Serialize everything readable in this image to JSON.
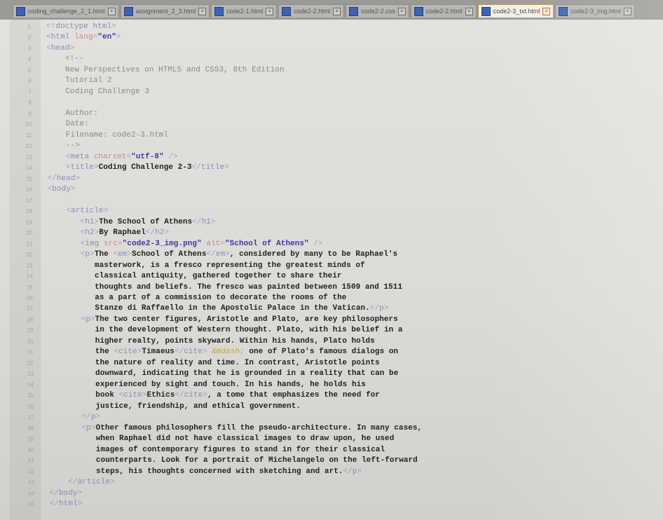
{
  "tabs": [
    {
      "label": "coding_challenge_2_1.html"
    },
    {
      "label": "assignment_2_3.html"
    },
    {
      "label": "code2-1.html"
    },
    {
      "label": "code2-2.html"
    },
    {
      "label": "code2-2.css"
    },
    {
      "label": "code2-2.html"
    },
    {
      "label": "code2-3_txt.html",
      "active": true
    },
    {
      "label": "code2-3_img.html"
    }
  ],
  "active_tab_color": "#d58e2a",
  "lines": [
    {
      "n": "1",
      "html": "<span class='ang'>&lt;!</span><span class='tag'>doctype html</span><span class='ang'>&gt;</span>"
    },
    {
      "n": "2",
      "html": "<span class='ang'>&lt;</span><span class='tag'>html</span> <span class='attr'>lang=</span><span class='val'>\"en\"</span><span class='ang'>&gt;</span>"
    },
    {
      "n": "3",
      "html": "<span class='ang'>&lt;</span><span class='tag'>head</span><span class='ang'>&gt;</span>"
    },
    {
      "n": "4",
      "html": "    <span class='cm'>&lt;!--</span>"
    },
    {
      "n": "5",
      "html": "    <span class='cm'>New Perspectives on HTML5 and CSS3, 8th Edition</span>"
    },
    {
      "n": "6",
      "html": "    <span class='cm'>Tutorial 2</span>"
    },
    {
      "n": "7",
      "html": "    <span class='cm'>Coding Challenge 3</span>"
    },
    {
      "n": "8",
      "html": ""
    },
    {
      "n": "9",
      "html": "    <span class='cm'>Author:</span>"
    },
    {
      "n": "10",
      "html": "    <span class='cm'>Date:</span>"
    },
    {
      "n": "11",
      "html": "    <span class='cm'>Filename: code2-3.html</span>"
    },
    {
      "n": "12",
      "html": "    <span class='cm'>--&gt;</span>"
    },
    {
      "n": "13",
      "html": "    <span class='ang'>&lt;</span><span class='tag'>meta</span> <span class='attr'>charset=</span><span class='val'>\"utf-8\"</span> <span class='ang'>/&gt;</span>"
    },
    {
      "n": "14",
      "html": "    <span class='ang'>&lt;</span><span class='tag'>title</span><span class='ang'>&gt;</span><span class='bold'>Coding Challenge 2-3</span><span class='ang'>&lt;/</span><span class='tag'>title</span><span class='ang'>&gt;</span>"
    },
    {
      "n": "15",
      "html": "<span class='ang'>&lt;/</span><span class='tag'>head</span><span class='ang'>&gt;</span>"
    },
    {
      "n": "16",
      "html": "<span class='ang'>&lt;</span><span class='tag'>body</span><span class='ang'>&gt;</span>"
    },
    {
      "n": "17",
      "html": ""
    },
    {
      "n": "18",
      "html": "    <span class='ang'>&lt;</span><span class='tag'>article</span><span class='ang'>&gt;</span>"
    },
    {
      "n": "19",
      "html": "       <span class='ang'>&lt;</span><span class='tag'>h1</span><span class='ang'>&gt;</span><span class='bold'>The School of Athens</span><span class='ang'>&lt;/</span><span class='tag'>h1</span><span class='ang'>&gt;</span>"
    },
    {
      "n": "20",
      "html": "       <span class='ang'>&lt;</span><span class='tag'>h2</span><span class='ang'>&gt;</span><span class='bold'>By Raphael</span><span class='ang'>&lt;/</span><span class='tag'>h2</span><span class='ang'>&gt;</span>"
    },
    {
      "n": "21",
      "html": "       <span class='ang'>&lt;</span><span class='tag'>img</span> <span class='attr'>src=</span><span class='val'>\"code2-3_img.png\"</span> <span class='attr'>alt=</span><span class='val'>\"School of Athens\"</span> <span class='ang'>/&gt;</span>"
    },
    {
      "n": "22",
      "html": "       <span class='ang'>&lt;</span><span class='tag'>p</span><span class='ang'>&gt;</span><span class='bold'>The </span><span class='ang'>&lt;</span><span class='tag'>em</span><span class='ang'>&gt;</span><span class='bold'>School of Athens</span><span class='ang'>&lt;/</span><span class='tag'>em</span><span class='ang'>&gt;</span><span class='bold'>, considered by many to be Raphael's</span>"
    },
    {
      "n": "23",
      "html": "          <span class='bold'>masterwork, is a fresco representing the greatest minds of</span>"
    },
    {
      "n": "24",
      "html": "          <span class='bold'>classical antiquity, gathered together to share their</span>"
    },
    {
      "n": "25",
      "html": "          <span class='bold'>thoughts and beliefs. The fresco was painted between 1509 and 1511</span>"
    },
    {
      "n": "26",
      "html": "          <span class='bold'>as a part of a commission to decorate the rooms of the</span>"
    },
    {
      "n": "27",
      "html": "          <span class='bold'>Stanze di Raffaello in the Apostolic Palace in the Vatican.</span><span class='ang'>&lt;/</span><span class='tag'>p</span><span class='ang'>&gt;</span>"
    },
    {
      "n": "28",
      "html": "       <span class='ang'>&lt;</span><span class='tag'>p</span><span class='ang'>&gt;</span><span class='bold'>The two center figures, Aristotle and Plato, are key philosophers</span>"
    },
    {
      "n": "29",
      "html": "          <span class='bold'>in the development of Western thought. Plato, with his belief in a</span>"
    },
    {
      "n": "30",
      "html": "          <span class='bold'>higher realty, points skyward. Within his hands, Plato holds</span>"
    },
    {
      "n": "31",
      "html": "          <span class='bold'>the </span><span class='ang'>&lt;</span><span class='tag'>cite</span><span class='ang'>&gt;</span><span class='bold'>Timaeus</span><span class='ang'>&lt;/</span><span class='tag'>cite</span><span class='ang'>&gt;</span> <span class='ent'>&amp;mdash;</span><span class='bold'> one of Plato's famous dialogs on</span>"
    },
    {
      "n": "32",
      "html": "          <span class='bold'>the nature of reality and time. In contrast, Aristotle points</span>"
    },
    {
      "n": "33",
      "html": "          <span class='bold'>downward, indicating that he is grounded in a reality that can be</span>"
    },
    {
      "n": "34",
      "html": "          <span class='bold'>experienced by sight and touch. In his hands, he holds his</span>"
    },
    {
      "n": "35",
      "html": "          <span class='bold'>book </span><span class='ang'>&lt;</span><span class='tag'>cite</span><span class='ang'>&gt;</span><span class='bold'>Ethics</span><span class='ang'>&lt;/</span><span class='tag'>cite</span><span class='ang'>&gt;</span><span class='bold'>, a tome that emphasizes the need for</span>"
    },
    {
      "n": "36",
      "html": "          <span class='bold'>justice, friendship, and ethical government.</span>"
    },
    {
      "n": "37",
      "html": "       <span class='ang'>&lt;/</span><span class='tag'>p</span><span class='ang'>&gt;</span>"
    },
    {
      "n": "38",
      "html": "       <span class='ang'>&lt;</span><span class='tag'>p</span><span class='ang'>&gt;</span><span class='bold'>Other famous philosophers fill the pseudo-architecture. In many cases,</span>"
    },
    {
      "n": "39",
      "html": "          <span class='bold'>when Raphael did not have classical images to draw upon, he used</span>"
    },
    {
      "n": "40",
      "html": "          <span class='bold'>images of contemporary figures to stand in for their classical</span>"
    },
    {
      "n": "41",
      "html": "          <span class='bold'>counterparts. Look for a portrait of Michelangelo on the left-forward</span>"
    },
    {
      "n": "42",
      "html": "          <span class='bold'>steps, his thoughts concerned with sketching and art.</span><span class='ang'>&lt;/</span><span class='tag'>p</span><span class='ang'>&gt;</span>"
    },
    {
      "n": "43",
      "html": "    <span class='ang'>&lt;/</span><span class='tag'>article</span><span class='ang'>&gt;</span>"
    },
    {
      "n": "44",
      "html": "<span class='ang'>&lt;/</span><span class='tag'>body</span><span class='ang'>&gt;</span>"
    },
    {
      "n": "45",
      "html": "<span class='ang'>&lt;/</span><span class='tag'>html</span><span class='ang'>&gt;</span>"
    }
  ]
}
